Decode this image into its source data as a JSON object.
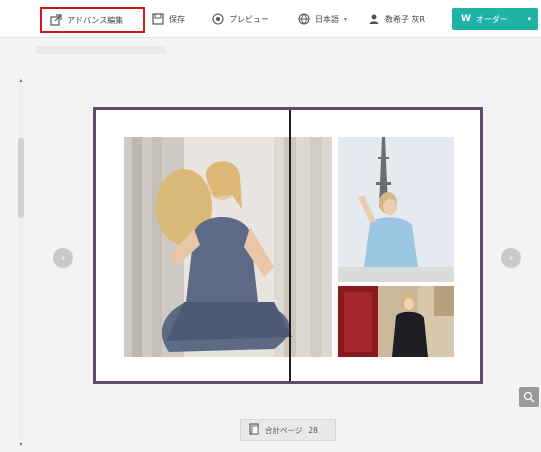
{
  "toolbar": {
    "advanced_edit_label": "アドバンス編集",
    "save_label": "保存",
    "preview_label": "プレビュー",
    "language_label": "日本語",
    "user_label": "数希子 灰R",
    "order_label": "オーダー"
  },
  "page_indicator": {
    "label": "合計ページ",
    "count": "28"
  },
  "colors": {
    "highlight": "#d0161f",
    "order_button": "#1fb3a6",
    "book_border": "#5f4a6b",
    "spine": "#1e1e1e"
  },
  "icons": {
    "advanced_edit": "external-edit-icon",
    "save": "save-icon",
    "preview": "eye-icon",
    "language": "globe-icon",
    "user": "user-icon",
    "order": "w-logo-icon",
    "prev": "chevron-left-icon",
    "next": "chevron-right-icon",
    "zoom": "zoom-icon",
    "page": "page-icon"
  }
}
